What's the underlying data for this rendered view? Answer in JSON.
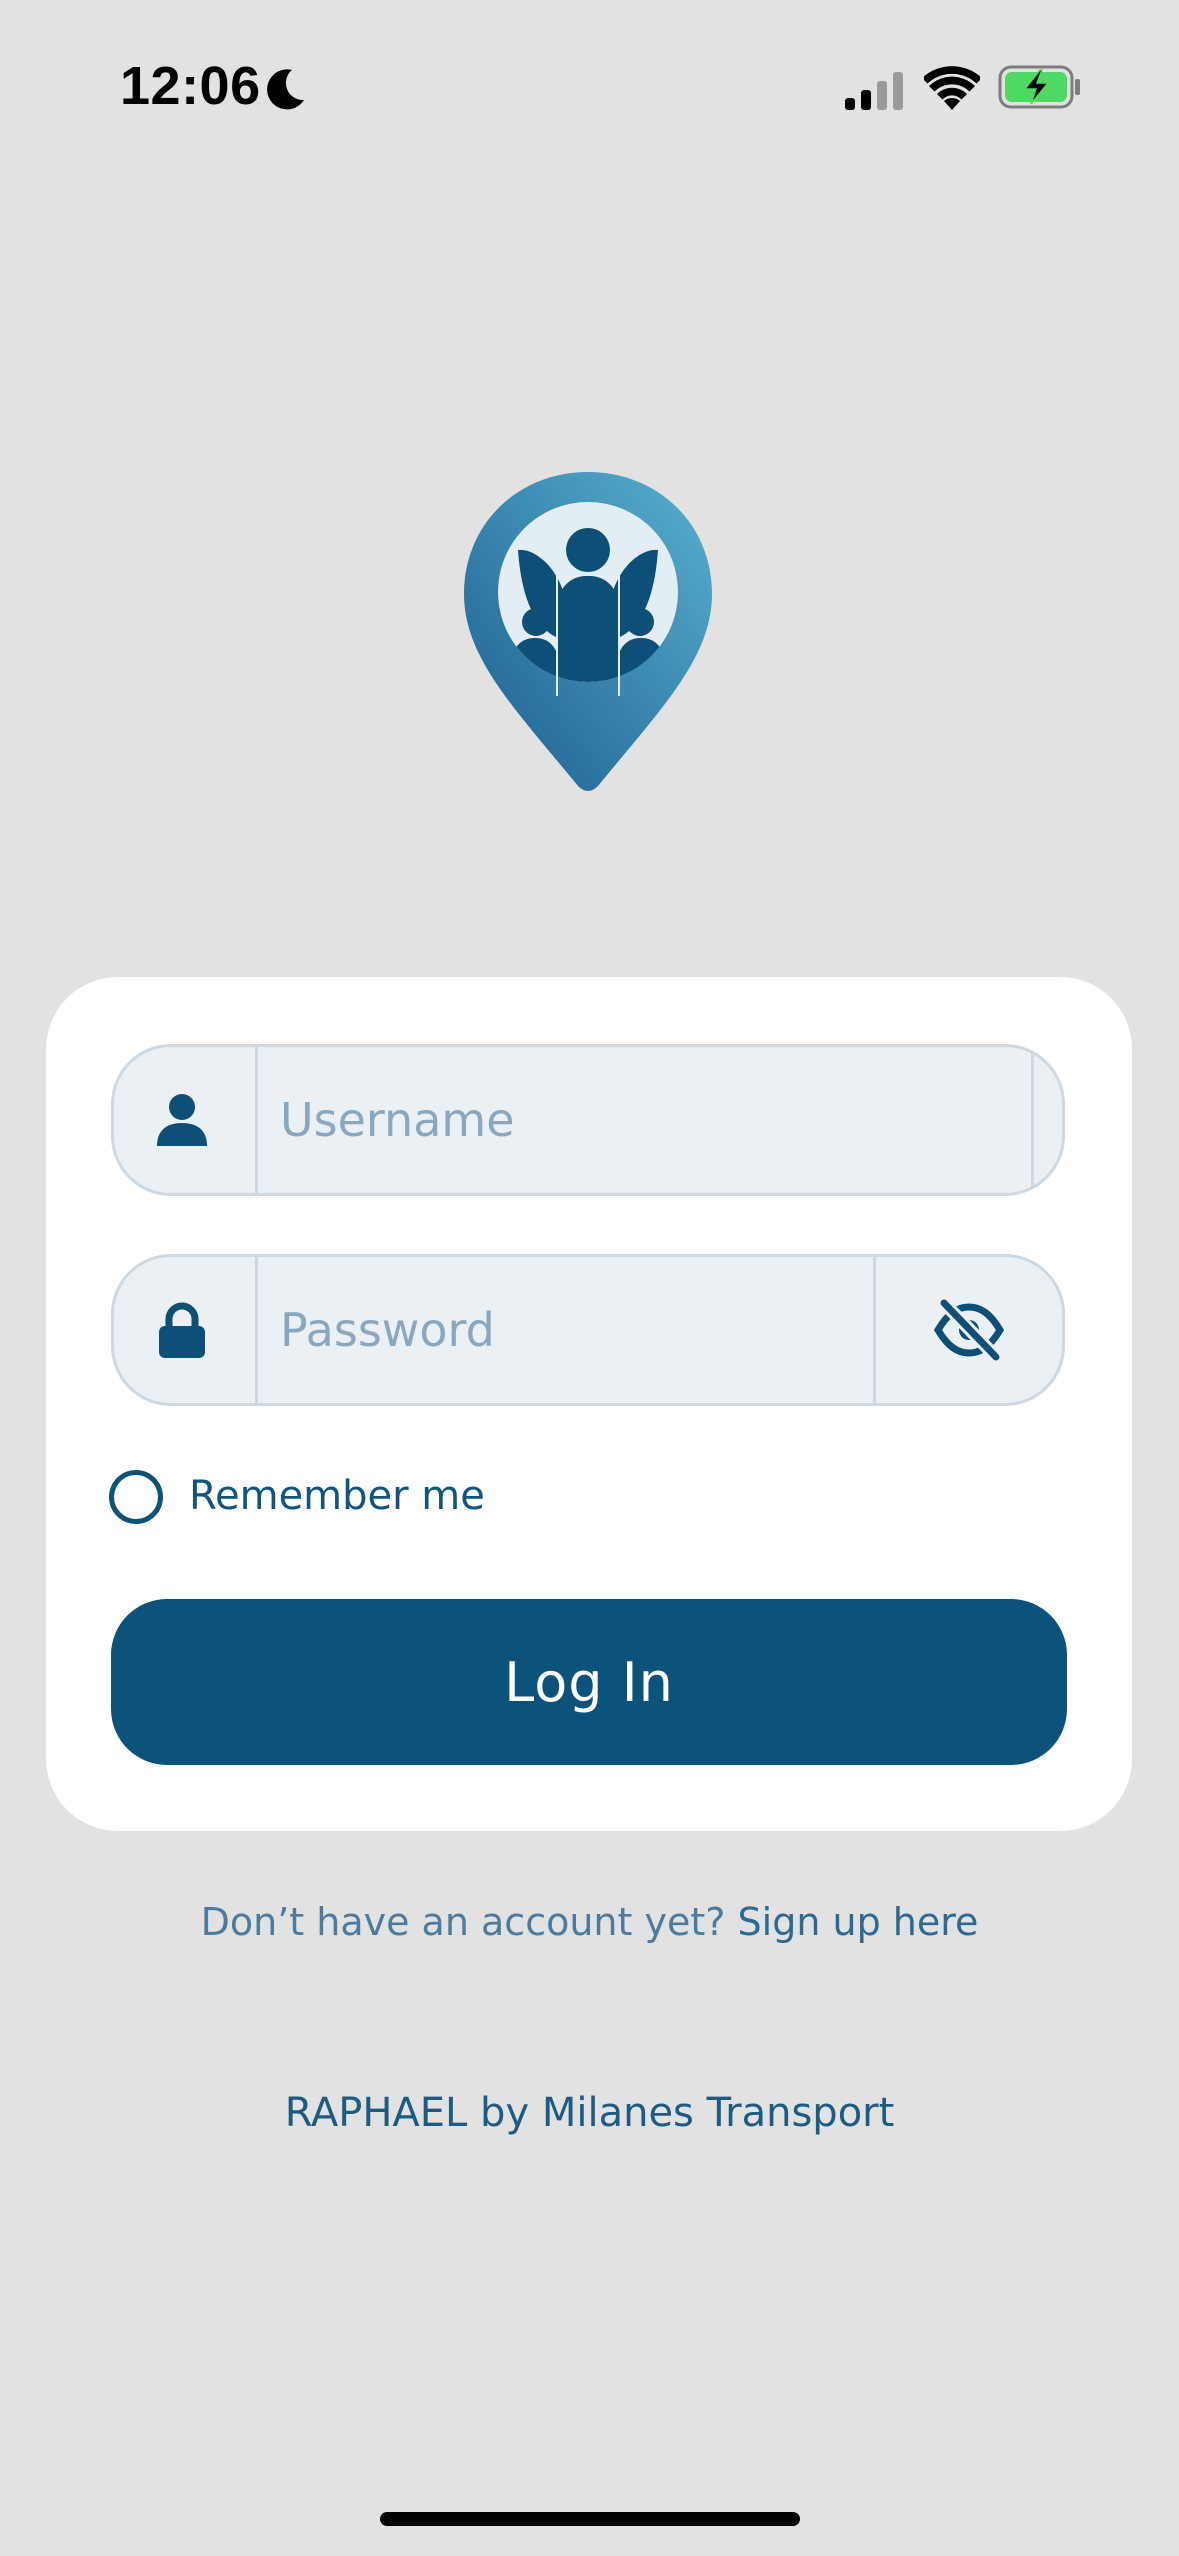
{
  "status_bar": {
    "time": "12:06",
    "focus_icon": "moon-icon",
    "signal_icon": "cellular-signal-icon",
    "wifi_icon": "wifi-icon",
    "battery_icon": "battery-charging-icon",
    "battery_color": "#4cd964"
  },
  "logo": {
    "icon": "location-pin-family-icon",
    "gradient_light": "#5ab0cf",
    "gradient_dark": "#1b5d8f"
  },
  "login_form": {
    "username": {
      "icon": "user-icon",
      "placeholder": "Username",
      "value": ""
    },
    "password": {
      "icon": "lock-icon",
      "placeholder": "Password",
      "value": "",
      "toggle_icon": "eye-slash-icon"
    },
    "remember_label": "Remember me",
    "remember_checked": false,
    "submit_label": "Log In"
  },
  "signup": {
    "prompt": "Don’t have an account yet?",
    "link": "Sign up here"
  },
  "footer": {
    "brand": "RAPHAEL by  Milanes Transport"
  },
  "colors": {
    "background": "#e2e2e2",
    "primary": "#0c537b",
    "field_background": "#ebf0f4",
    "field_border": "#ccd8e2",
    "placeholder": "#89a7bf"
  }
}
